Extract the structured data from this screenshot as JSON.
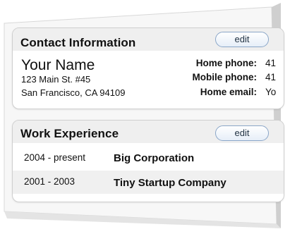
{
  "contact": {
    "title": "Contact Information",
    "edit_label": "edit",
    "name": "Your Name",
    "address_line1": "123 Main St. #45",
    "address_line2": "San Francisco, CA 94109",
    "fields": [
      {
        "label": "Home phone:",
        "value": "41"
      },
      {
        "label": "Mobile phone:",
        "value": "41"
      },
      {
        "label": "Home email:",
        "value": "Yo"
      }
    ]
  },
  "work": {
    "title": "Work Experience",
    "edit_label": "edit",
    "jobs": [
      {
        "years": "2004 - present",
        "company": "Big Corporation"
      },
      {
        "years": "2001 - 2003",
        "company": "Tiny Startup Company"
      }
    ]
  }
}
